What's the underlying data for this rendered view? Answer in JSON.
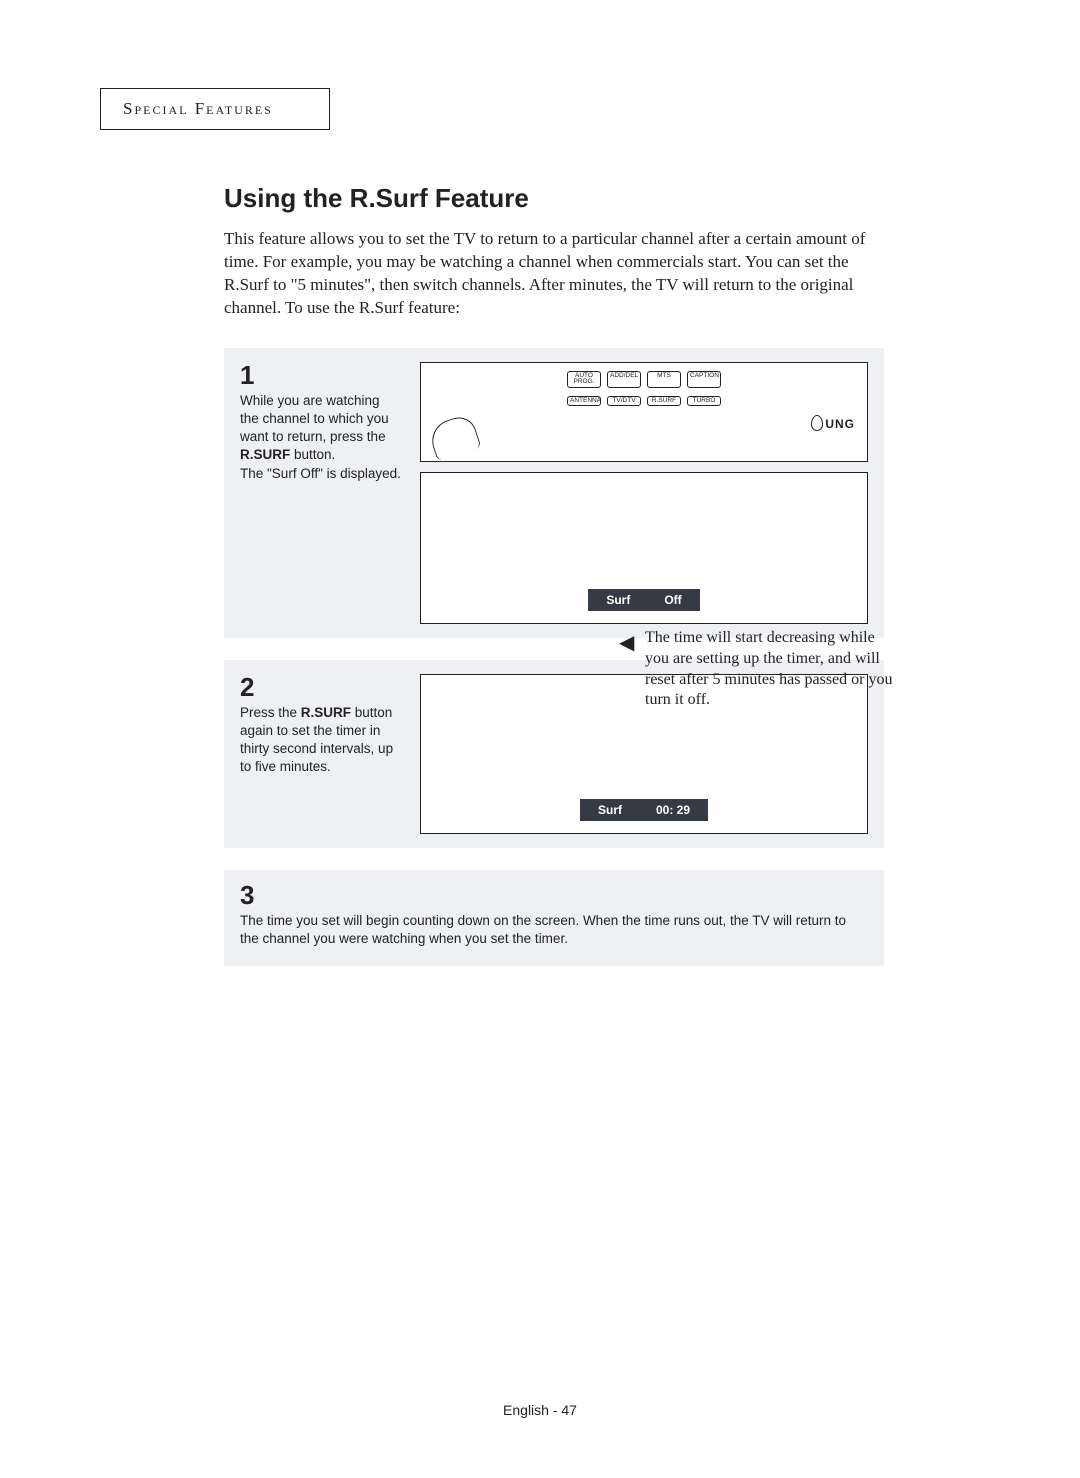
{
  "section_header": "Special Features",
  "title": "Using the R.Surf Feature",
  "intro": "This feature allows you to set the TV to return to a particular channel after a certain amount of time. For example, you may be watching a channel when commercials start. You can set the R.Surf to \"5 minutes\", then switch channels. After minutes, the TV will return to the original channel. To use the R.Surf feature:",
  "steps": {
    "s1": {
      "num": "1",
      "text_before": "While you are watching the channel to which you want to return, press the ",
      "button_name": "R.SURF",
      "text_mid": " button.\nThe \"Surf Off\" is displayed.",
      "osd_label": "Surf",
      "osd_value": "Off"
    },
    "s2": {
      "num": "2",
      "text_before": "Press the ",
      "button_name": "R.SURF",
      "text_after": " button again to set the timer in thirty second intervals, up to five minutes.",
      "osd_label": "Surf",
      "osd_value": "00:  29"
    },
    "s3": {
      "num": "3",
      "text": "The time you set will begin counting down on the screen. When the time runs out, the TV will return to the channel you were watching when you set the timer."
    }
  },
  "side_note": "The time will start decreasing while you are setting up the timer, and will reset after 5 minutes has passed or you turn it off.",
  "remote_buttons_row1": [
    "AUTO PROG.",
    "ADD/DEL",
    "MTS",
    "CAPTION"
  ],
  "remote_buttons_row2": [
    "ANTENNA",
    "TV/DTV",
    "R.SURF",
    "TURBO"
  ],
  "remote_brand": "UNG",
  "footer": "English - 47"
}
